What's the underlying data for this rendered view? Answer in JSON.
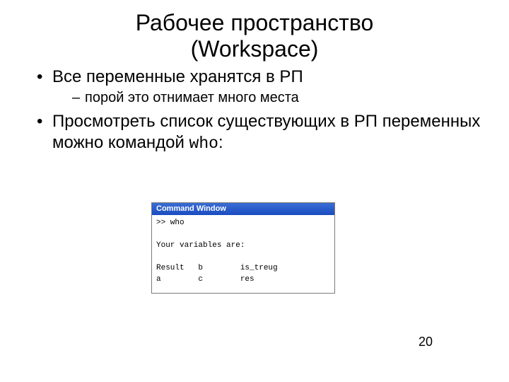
{
  "title_line1": "Рабочее пространство",
  "title_line2": "(Workspace)",
  "bullets": {
    "b1": "Все переменные хранятся в РП",
    "b1_sub1": "порой это отнимает много места",
    "b2_pre": "Просмотреть список существующих в РП переменных можно командой ",
    "b2_code": "who",
    "b2_post": ":"
  },
  "command_window": {
    "title": "Command Window",
    "content": ">> who\n\nYour variables are:\n\nResult   b        is_treug\na        c        res"
  },
  "page_number": "20"
}
